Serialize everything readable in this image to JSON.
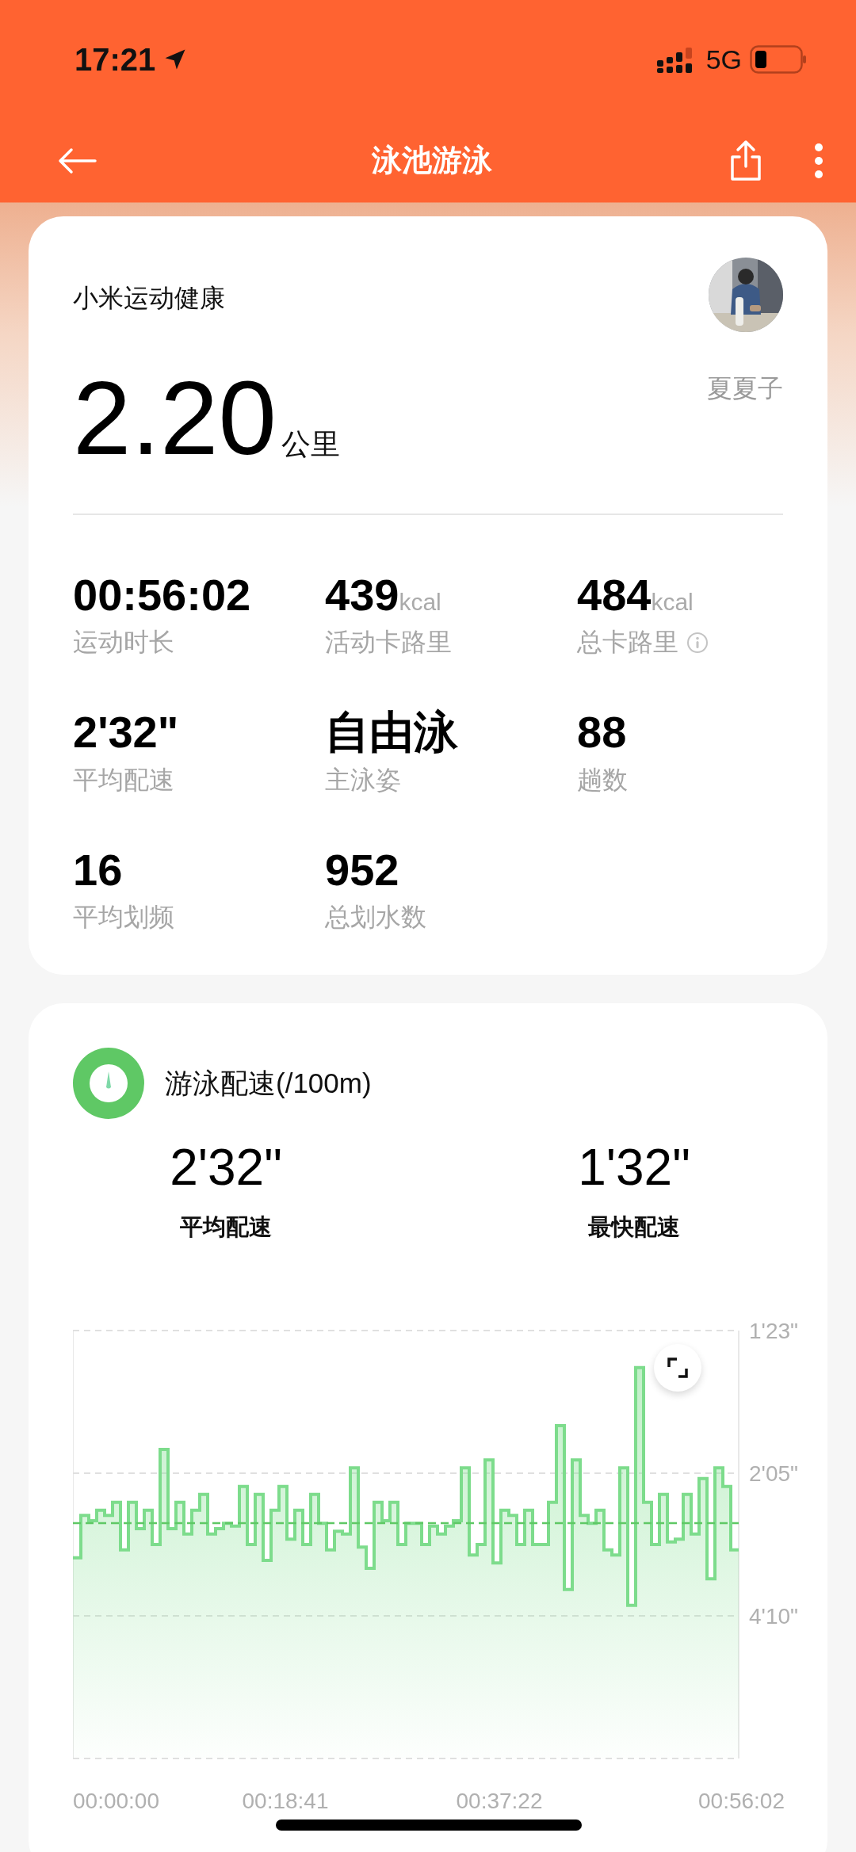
{
  "status_bar": {
    "time": "17:21",
    "network": "5G"
  },
  "nav": {
    "title": "泳池游泳"
  },
  "summary_card": {
    "app_name": "小米运动健康",
    "user_name": "夏夏子",
    "distance": "2.20",
    "distance_unit": "公里",
    "stats": [
      {
        "value": "00:56:02",
        "label": "运动时长"
      },
      {
        "value": "439",
        "unit": "kcal",
        "label": "活动卡路里"
      },
      {
        "value": "484",
        "unit": "kcal",
        "label": "总卡路里",
        "info": true
      },
      {
        "value": "2'32\"",
        "label": "平均配速"
      },
      {
        "value": "自由泳",
        "label": "主泳姿"
      },
      {
        "value": "88",
        "label": "趟数"
      },
      {
        "value": "16",
        "label": "平均划频"
      },
      {
        "value": "952",
        "label": "总划水数"
      }
    ]
  },
  "pace_card": {
    "title": "游泳配速(/100m)",
    "metrics": [
      {
        "value": "2'32\"",
        "label": "平均配速"
      },
      {
        "value": "1'32\"",
        "label": "最快配速"
      }
    ],
    "y_ticks": [
      "1'23\"",
      "2'05\"",
      "4'10\""
    ],
    "x_ticks": [
      "00:00:00",
      "00:18:41",
      "00:37:22",
      "00:56:02"
    ]
  }
}
